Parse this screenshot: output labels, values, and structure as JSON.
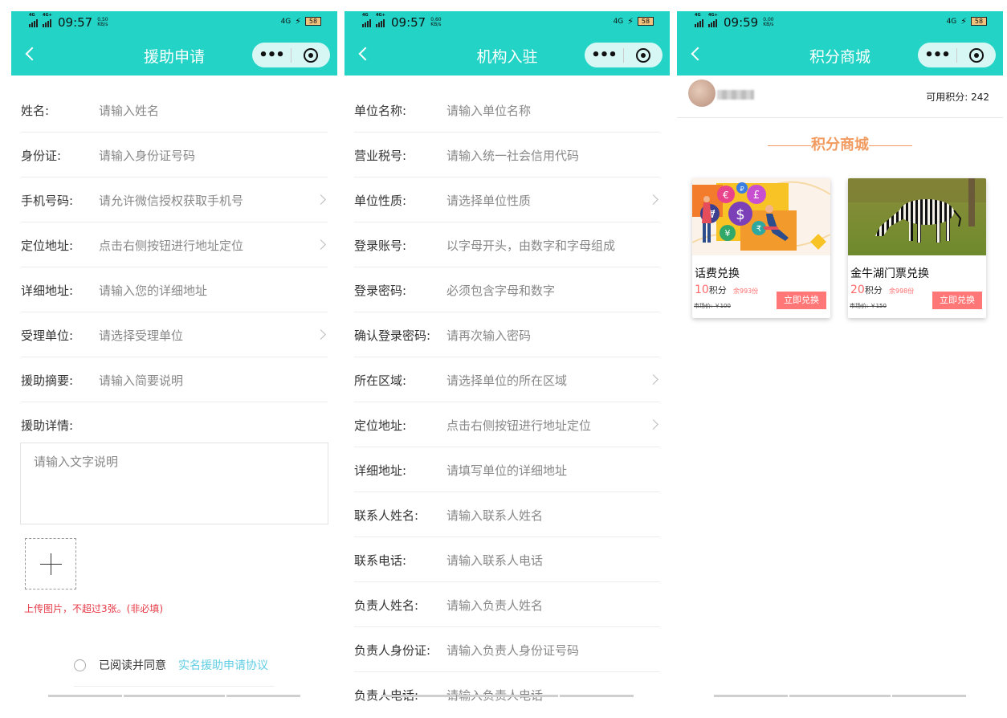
{
  "status": [
    {
      "time": "09:57",
      "speed_top": "0.50",
      "speed_bottom": "KB/s",
      "net1": "4G",
      "net2": "4G+",
      "battery": "58"
    },
    {
      "time": "09:57",
      "speed_top": "0.60",
      "speed_bottom": "KB/s",
      "net1": "4G",
      "net2": "4G+",
      "battery": "58"
    },
    {
      "time": "09:59",
      "speed_top": "0.00",
      "speed_bottom": "KB/s",
      "net1": "4G",
      "net2": "4G+",
      "battery": "58"
    }
  ],
  "capsule": {
    "more": "•••"
  },
  "screen1": {
    "title": "援助申请",
    "rows": [
      {
        "label": "姓名:",
        "placeholder": "请输入姓名"
      },
      {
        "label": "身份证:",
        "placeholder": "请输入身份证号码"
      },
      {
        "label": "手机号码:",
        "placeholder": "请允许微信授权获取手机号"
      },
      {
        "label": "定位地址:",
        "placeholder": "点击右侧按钮进行地址定位"
      },
      {
        "label": "详细地址:",
        "placeholder": "请输入您的详细地址"
      },
      {
        "label": "受理单位:",
        "placeholder": "请选择受理单位"
      },
      {
        "label": "援助摘要:",
        "placeholder": "请输入简要说明"
      },
      {
        "label": "援助详情:",
        "placeholder": ""
      }
    ],
    "textarea_placeholder": "请输入文字说明",
    "upload_tip": "上传图片，不超过3张。(非必填)",
    "agree_text": "已阅读并同意",
    "agree_link": "实名援助申请协议"
  },
  "screen2": {
    "title": "机构入驻",
    "rows": [
      {
        "label": "单位名称:",
        "placeholder": "请输入单位名称"
      },
      {
        "label": "营业税号:",
        "placeholder": "请输入统一社会信用代码"
      },
      {
        "label": "单位性质:",
        "placeholder": "请选择单位性质"
      },
      {
        "label": "登录账号:",
        "placeholder": "以字母开头，由数字和字母组成"
      },
      {
        "label": "登录密码:",
        "placeholder": "必须包含字母和数字"
      },
      {
        "label": "确认登录密码:",
        "placeholder": "请再次输入密码"
      },
      {
        "label": "所在区域:",
        "placeholder": "请选择单位的所在区域"
      },
      {
        "label": "定位地址:",
        "placeholder": "点击右侧按钮进行地址定位"
      },
      {
        "label": "详细地址:",
        "placeholder": "请填写单位的详细地址"
      },
      {
        "label": "联系人姓名:",
        "placeholder": "请输入联系人姓名"
      },
      {
        "label": "联系电话:",
        "placeholder": "请输入联系人电话"
      },
      {
        "label": "负责人姓名:",
        "placeholder": "请输入负责人姓名"
      },
      {
        "label": "负责人身份证:",
        "placeholder": "请输入负责人身份证号码"
      },
      {
        "label": "负责人电话:",
        "placeholder": "请输入负责人电话"
      }
    ]
  },
  "screen3": {
    "title": "积分商城",
    "points": "可用积分: 242",
    "section_title": "积分商城",
    "products": [
      {
        "name": "话费兑换",
        "points": "10",
        "unit": "积分",
        "stock": "余993份",
        "market": "市场价: ￥100",
        "button": "立即兑换"
      },
      {
        "name": "金牛湖门票兑换",
        "points": "20",
        "unit": "积分",
        "stock": "余998份",
        "market": "市场价: ￥150",
        "button": "立即兑换"
      }
    ]
  },
  "colors": {
    "primary": "#22d3c6",
    "accent": "#f29b61",
    "danger": "#e63946",
    "link": "#5fcde4",
    "button": "#ff7777"
  }
}
